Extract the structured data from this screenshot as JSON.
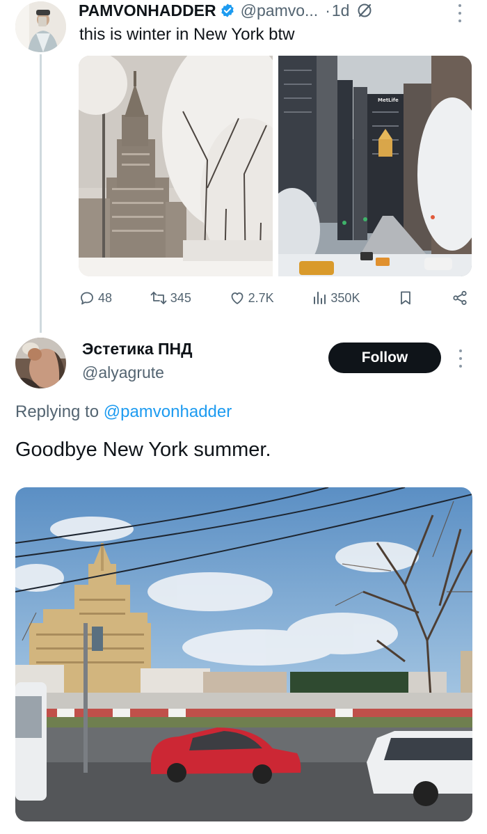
{
  "tweet": {
    "author_name": "PAMVONHADDER",
    "author_handle": "@pamvo...",
    "separator": "·",
    "time": "1d",
    "text": "this is winter in New York btw",
    "stats": {
      "replies": "48",
      "retweets": "345",
      "likes": "2.7K",
      "views": "350K"
    }
  },
  "reply": {
    "author_name": "Эстетика ПНД",
    "author_handle": "@alyagrute",
    "follow_label": "Follow",
    "replying_prefix": "Replying to",
    "replying_handle": "@pamvonhadder",
    "text": "Goodbye New York summer."
  },
  "photo_signs": {
    "metlife": "MetLife"
  },
  "colors": {
    "accent": "#1d9bf0",
    "muted": "#536471",
    "verified": "#1d9bf0",
    "follow_bg": "#0f1419"
  }
}
